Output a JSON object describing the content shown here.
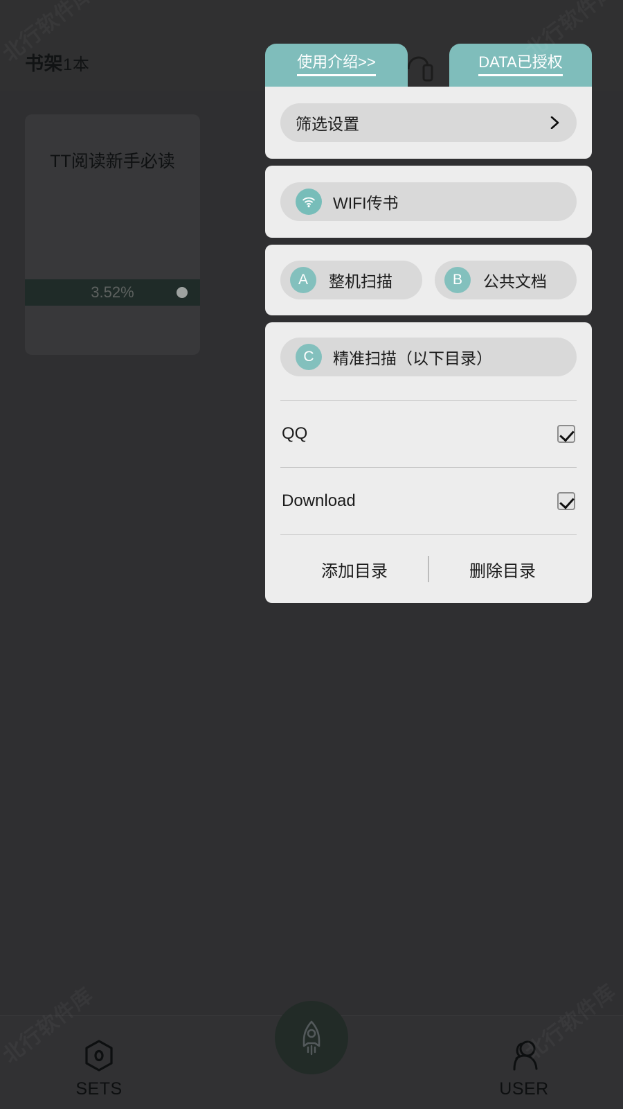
{
  "colors": {
    "background": "#2f2f31",
    "header_bg": "#303031",
    "accent_teal": "#7fbdbb",
    "panel_bg": "#ededed",
    "pill_bg": "#d9d9d9",
    "progress_bar": "#1f2b28",
    "fab_bg": "#222b27"
  },
  "watermark": {
    "text": "北行软件库"
  },
  "header": {
    "title": "书架",
    "count": "1本"
  },
  "shelf": {
    "book": {
      "title": "TT阅读新手必读",
      "progress_label": "3.52%",
      "progress_value": 3.52
    }
  },
  "overlay": {
    "tabs": [
      {
        "id": "intro",
        "label": "使用介绍>>"
      },
      {
        "id": "data-auth",
        "label": "DATA已授权"
      }
    ],
    "gap_icon": "headphone-icon",
    "panel_filter": {
      "row": {
        "label": "筛选设置",
        "icon": "chevron-right-icon"
      }
    },
    "panel_wifi": {
      "row": {
        "label": "WIFI传书",
        "icon": "wifi-icon"
      }
    },
    "panel_scan": {
      "rows": [
        {
          "badge": "A",
          "label": "整机扫描"
        },
        {
          "badge": "B",
          "label": "公共文档"
        }
      ]
    },
    "panel_precise": {
      "header": {
        "badge": "C",
        "label": "精准扫描（以下目录）"
      },
      "directories": [
        {
          "name": "QQ",
          "checked": true
        },
        {
          "name": "Download",
          "checked": true
        }
      ],
      "actions": [
        {
          "id": "add-dir",
          "label": "添加目录"
        },
        {
          "id": "delete-dir",
          "label": "删除目录"
        }
      ]
    }
  },
  "bottom_nav": {
    "items": [
      {
        "id": "sets",
        "label": "SETS",
        "icon": "hexagon-gear-icon"
      },
      {
        "id": "user",
        "label": "USER",
        "icon": "user-icon"
      }
    ],
    "fab": {
      "id": "boost",
      "icon": "rocket-icon"
    }
  }
}
